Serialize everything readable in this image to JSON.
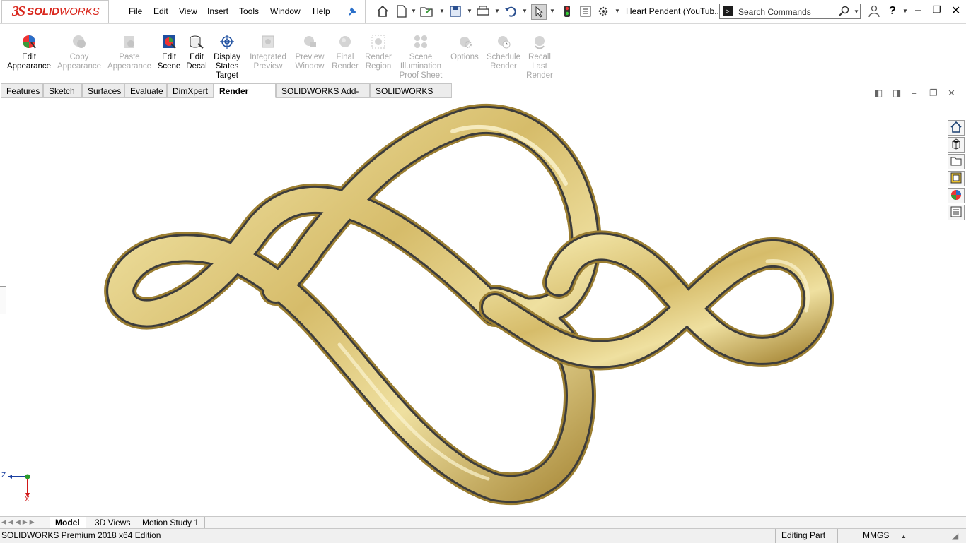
{
  "app": {
    "logo_mark": "3S",
    "logo_text_bold": "SOLID",
    "logo_text_light": "WORKS",
    "document_title": "Heart Pendent (YouTub..."
  },
  "menu": [
    "File",
    "Edit",
    "View",
    "Insert",
    "Tools",
    "Window",
    "Help"
  ],
  "search": {
    "placeholder": "Search Commands"
  },
  "command_manager": {
    "tools": [
      {
        "label_lines": [
          "Edit",
          "Appearance"
        ],
        "enabled": true
      },
      {
        "label_lines": [
          "Copy",
          "Appearance"
        ],
        "enabled": false
      },
      {
        "label_lines": [
          "Paste",
          "Appearance"
        ],
        "enabled": false
      },
      {
        "label_lines": [
          "Edit",
          "Scene"
        ],
        "enabled": true
      },
      {
        "label_lines": [
          "Edit",
          "Decal"
        ],
        "enabled": true
      },
      {
        "label_lines": [
          "Display",
          "States",
          "Target"
        ],
        "enabled": true
      },
      {
        "label_lines": [
          "Integrated",
          "Preview"
        ],
        "enabled": false
      },
      {
        "label_lines": [
          "Preview",
          "Window"
        ],
        "enabled": false
      },
      {
        "label_lines": [
          "Final",
          "Render"
        ],
        "enabled": false
      },
      {
        "label_lines": [
          "Render",
          "Region"
        ],
        "enabled": false
      },
      {
        "label_lines": [
          "Scene",
          "Illumination",
          "Proof Sheet"
        ],
        "enabled": false
      },
      {
        "label_lines": [
          "Options"
        ],
        "enabled": false
      },
      {
        "label_lines": [
          "Schedule",
          "Render"
        ],
        "enabled": false
      },
      {
        "label_lines": [
          "Recall",
          "Last",
          "Render"
        ],
        "enabled": false
      }
    ]
  },
  "tabs": [
    "Features",
    "Sketch",
    "Surfaces",
    "Evaluate",
    "DimXpert",
    "Render Tools",
    "SOLIDWORKS Add-Ins",
    "SOLIDWORKS MBD"
  ],
  "active_tab": "Render Tools",
  "triad": {
    "axis1": "Z",
    "axis2": "X"
  },
  "bottom_tabs": [
    "Model",
    "3D Views",
    "Motion Study 1"
  ],
  "active_bottom_tab": "Model",
  "status": {
    "edition": "SOLIDWORKS Premium 2018 x64 Edition",
    "mode": "Editing Part",
    "units": "MMGS"
  },
  "colors": {
    "gold_light": "#f3e6a0",
    "gold_mid": "#d4b866",
    "gold_dark": "#9c7f32",
    "groove": "#3c3c3c",
    "brand_red": "#d9261c"
  }
}
